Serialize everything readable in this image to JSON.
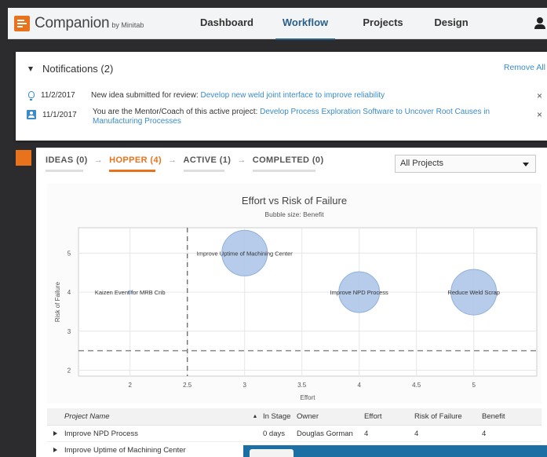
{
  "app": {
    "brand": "Companion",
    "brand_sub": "by Minitab"
  },
  "nav": {
    "items": [
      {
        "label": "Dashboard"
      },
      {
        "label": "Workflow"
      },
      {
        "label": "Projects"
      },
      {
        "label": "Design"
      }
    ],
    "active": "Workflow"
  },
  "notifications": {
    "title": "Notifications (2)",
    "remove_all": "Remove All",
    "items": [
      {
        "icon": "lightbulb-icon",
        "date": "11/2/2017",
        "text": "New idea submitted for review: ",
        "link": "Develop new weld joint interface to improve reliability",
        "close": "×"
      },
      {
        "icon": "person-badge-icon",
        "date": "11/1/2017",
        "text": "You are the Mentor/Coach of this active project: ",
        "link": "Develop Process Exploration Software to Uncover Root Causes in Manufacturing Processes",
        "close": "×"
      }
    ]
  },
  "pipeline": {
    "stages": [
      {
        "label": "IDEAS (0)"
      },
      {
        "label": "HOPPER (4)"
      },
      {
        "label": "ACTIVE (1)"
      },
      {
        "label": "COMPLETED (0)"
      }
    ],
    "active": "HOPPER (4)",
    "arrow": "→"
  },
  "filter": {
    "selected": "All Projects"
  },
  "chart_data": {
    "type": "scatter",
    "title": "Effort vs Risk of Failure",
    "subtitle": "Bubble size: Benefit",
    "xlabel": "Effort",
    "ylabel": "Risk of Failure",
    "xlim": [
      1.55,
      5.55
    ],
    "ylim": [
      1.85,
      5.65
    ],
    "x_ticks": [
      "2",
      "2.5",
      "3",
      "3.5",
      "4",
      "4.5",
      "5"
    ],
    "y_ticks": [
      "2",
      "3",
      "4",
      "5"
    ],
    "grid": true,
    "reference_lines": {
      "x": 2.5,
      "y": 2.5
    },
    "points": [
      {
        "label": "Kaizen Event for MRB Crib",
        "x": 2,
        "y": 4,
        "benefit": 0
      },
      {
        "label": "Improve Uptime of Machining Center",
        "x": 3,
        "y": 5,
        "benefit": 5
      },
      {
        "label": "Improve NPD Process",
        "x": 4,
        "y": 4,
        "benefit": 4
      },
      {
        "label": "Reduce Weld Scrap",
        "x": 5,
        "y": 4,
        "benefit": 5
      }
    ],
    "bubble_color": "#a9c3e6"
  },
  "table": {
    "headers": {
      "name": "Project Name",
      "sort": "▲",
      "stage": "In Stage",
      "owner": "Owner",
      "effort": "Effort",
      "risk": "Risk of Failure",
      "benefit": "Benefit"
    },
    "rows": [
      {
        "name": "Improve NPD Process",
        "stage": "0 days",
        "owner": "Douglas Gorman",
        "effort": "4",
        "risk": "4",
        "benefit": "4"
      },
      {
        "name": "Improve Uptime of Machining Center",
        "stage": "",
        "owner": "",
        "effort": "",
        "risk": "",
        "benefit": ""
      }
    ]
  },
  "colors": {
    "accent": "#e8731c",
    "link": "#3a8bc8",
    "nav_active": "#2a5f8a"
  }
}
